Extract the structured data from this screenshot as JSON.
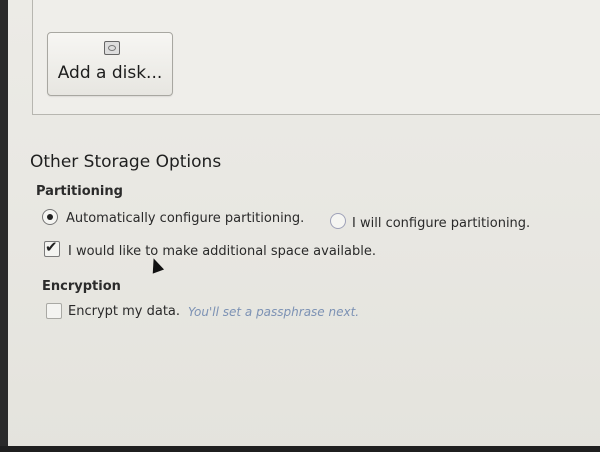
{
  "disk_panel": {
    "add_disk_label": "Add a disk..."
  },
  "other_storage": {
    "title": "Other Storage Options",
    "partitioning": {
      "heading": "Partitioning",
      "option_auto": "Automatically configure partitioning.",
      "option_manual": "I will configure partitioning.",
      "selected": "auto",
      "additional_space_label": "I would like to make additional space available.",
      "additional_space_checked": true
    },
    "encryption": {
      "heading": "Encryption",
      "encrypt_label": "Encrypt my data.",
      "encrypt_hint": "You'll set a passphrase next.",
      "encrypt_checked": false
    }
  },
  "icons": {
    "disk": "disk-icon",
    "pointer": "mouse-pointer-icon"
  }
}
